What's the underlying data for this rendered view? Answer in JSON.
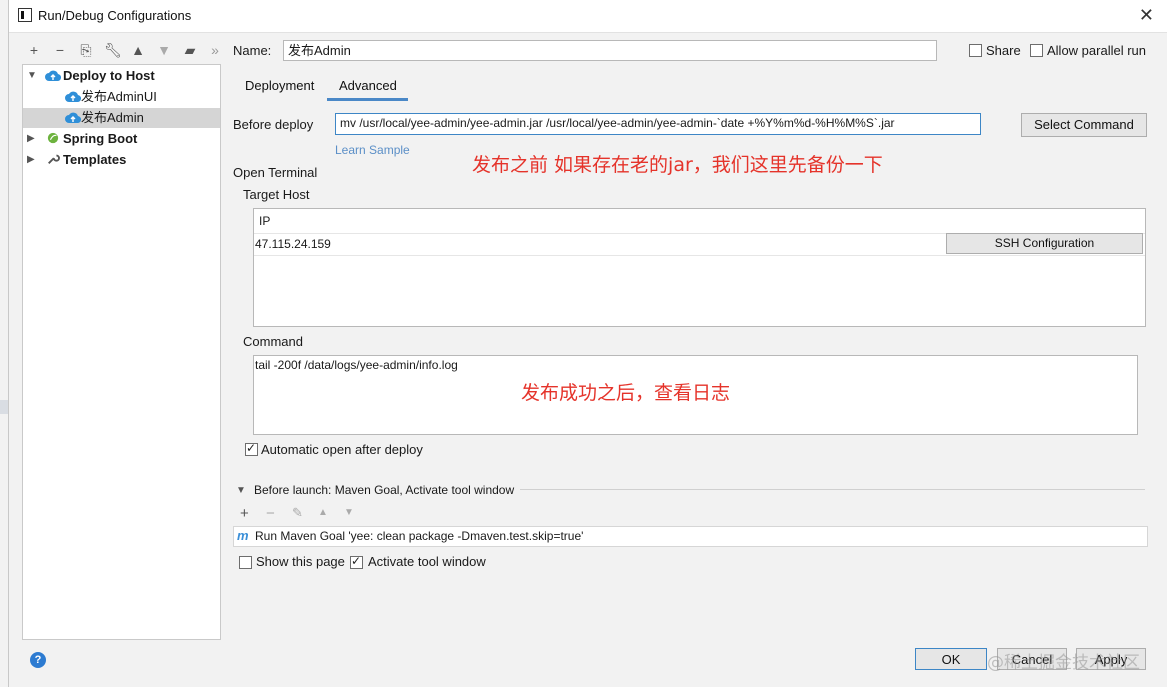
{
  "window": {
    "title": "Run/Debug Configurations"
  },
  "toolbar": {
    "buttons": [
      "add-icon",
      "remove-icon",
      "copy-icon",
      "wrench-icon",
      "move-up-icon",
      "move-down-icon",
      "folder-icon",
      "more-icon"
    ]
  },
  "tree": {
    "items": [
      {
        "label": "Deploy to Host",
        "bold": true
      },
      {
        "label": "发布AdminUI"
      },
      {
        "label": "发布Admin",
        "selected": true
      },
      {
        "label": "Spring Boot",
        "bold": true
      },
      {
        "label": "Templates",
        "bold": true
      }
    ]
  },
  "name": {
    "label": "Name:",
    "value": "发布Admin"
  },
  "share": {
    "label": "Share",
    "checked": false
  },
  "parallel": {
    "label": "Allow parallel run",
    "checked": false
  },
  "tabs": [
    {
      "label": "Deployment",
      "active": false
    },
    {
      "label": "Advanced",
      "active": true
    }
  ],
  "before_deploy": {
    "label": "Before deploy",
    "value": "mv /usr/local/yee-admin/yee-admin.jar /usr/local/yee-admin/yee-admin-`date +%Y%m%d-%H%M%S`.jar",
    "select_button": "Select Command",
    "learn_sample": "Learn Sample",
    "annotation": "发布之前 如果存在老的jar，我们这里先备份一下"
  },
  "open_terminal": {
    "label": "Open Terminal",
    "target_host_label": "Target Host",
    "column_header": "IP",
    "ip": "47.115.24.159",
    "ssh_button": "SSH Configuration",
    "command_label": "Command",
    "command_value": "tail -200f /data/logs/yee-admin/info.log",
    "command_annotation": "发布成功之后，查看日志",
    "auto_open_label": "Automatic open after deploy",
    "auto_open_checked": true
  },
  "before_launch": {
    "header": "Before launch: Maven Goal, Activate tool window",
    "task": "Run Maven Goal 'yee: clean package -Dmaven.test.skip=true'"
  },
  "show_page": {
    "label": "Show this page",
    "checked": false
  },
  "activate_tool": {
    "label": "Activate tool window",
    "checked": true
  },
  "footer": {
    "ok": "OK",
    "cancel": "Cancel",
    "apply": "Apply",
    "help": "?"
  },
  "watermark": "@稀土掘金技术社区",
  "colors": {
    "accent": "#4a88c7",
    "link": "#5b8fc7",
    "annotation": "#e5332a",
    "selection": "#d5d5d5"
  }
}
